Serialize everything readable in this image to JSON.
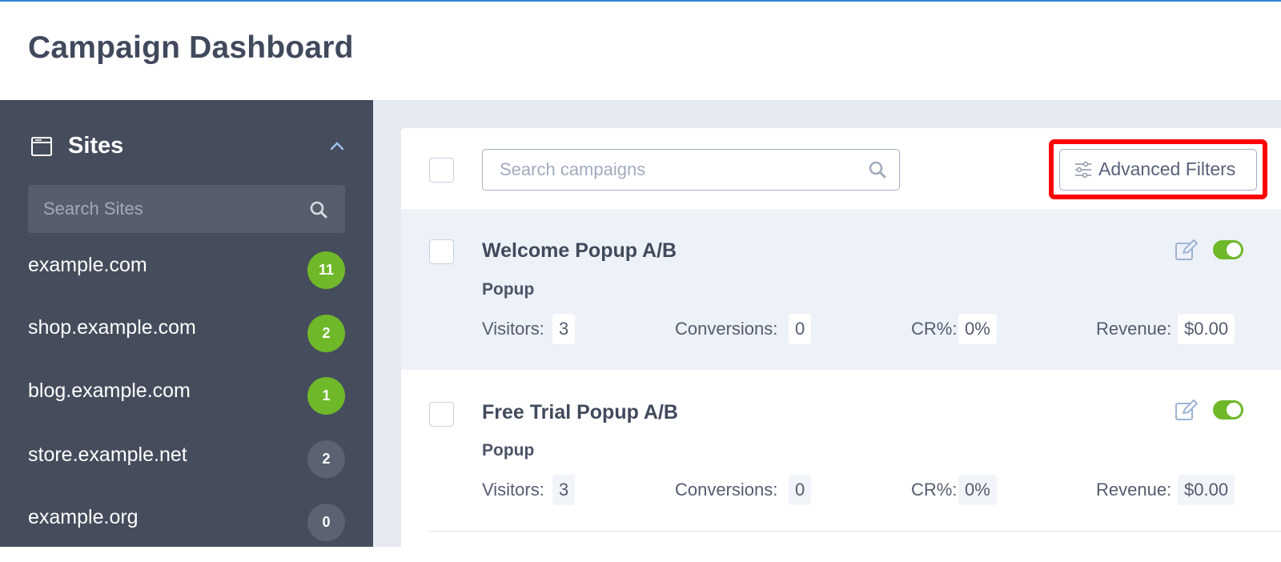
{
  "header": {
    "title": "Campaign Dashboard"
  },
  "sidebar": {
    "title": "Sites",
    "search_placeholder": "Search Sites",
    "items": [
      {
        "name": "example.com",
        "count": "11",
        "badge_color": "#6fb82a"
      },
      {
        "name": "shop.example.com",
        "count": "2",
        "badge_color": "#6fb82a"
      },
      {
        "name": "blog.example.com",
        "count": "1",
        "badge_color": "#6fb82a"
      },
      {
        "name": "store.example.net",
        "count": "2",
        "badge_color": "#5b6271"
      },
      {
        "name": "example.org",
        "count": "0",
        "badge_color": "#5b6271"
      }
    ]
  },
  "toolbar": {
    "search_placeholder": "Search campaigns",
    "advanced_filters_label": "Advanced Filters"
  },
  "campaigns": [
    {
      "name": "Welcome Popup A/B",
      "type": "Popup",
      "enabled": true,
      "visitors_label": "Visitors:",
      "visitors": "3",
      "conversions_label": "Conversions:",
      "conversions": "0",
      "cr_label": "CR%:",
      "cr": "0%",
      "revenue_label": "Revenue:",
      "revenue": "$0.00"
    },
    {
      "name": "Free Trial Popup A/B",
      "type": "Popup",
      "enabled": true,
      "visitors_label": "Visitors:",
      "visitors": "3",
      "conversions_label": "Conversions:",
      "conversions": "0",
      "cr_label": "CR%:",
      "cr": "0%",
      "revenue_label": "Revenue:",
      "revenue": "$0.00"
    }
  ],
  "colors": {
    "accent_green": "#6fb82a",
    "sidebar_bg": "#454c5b",
    "highlight_red": "#ff0000"
  }
}
